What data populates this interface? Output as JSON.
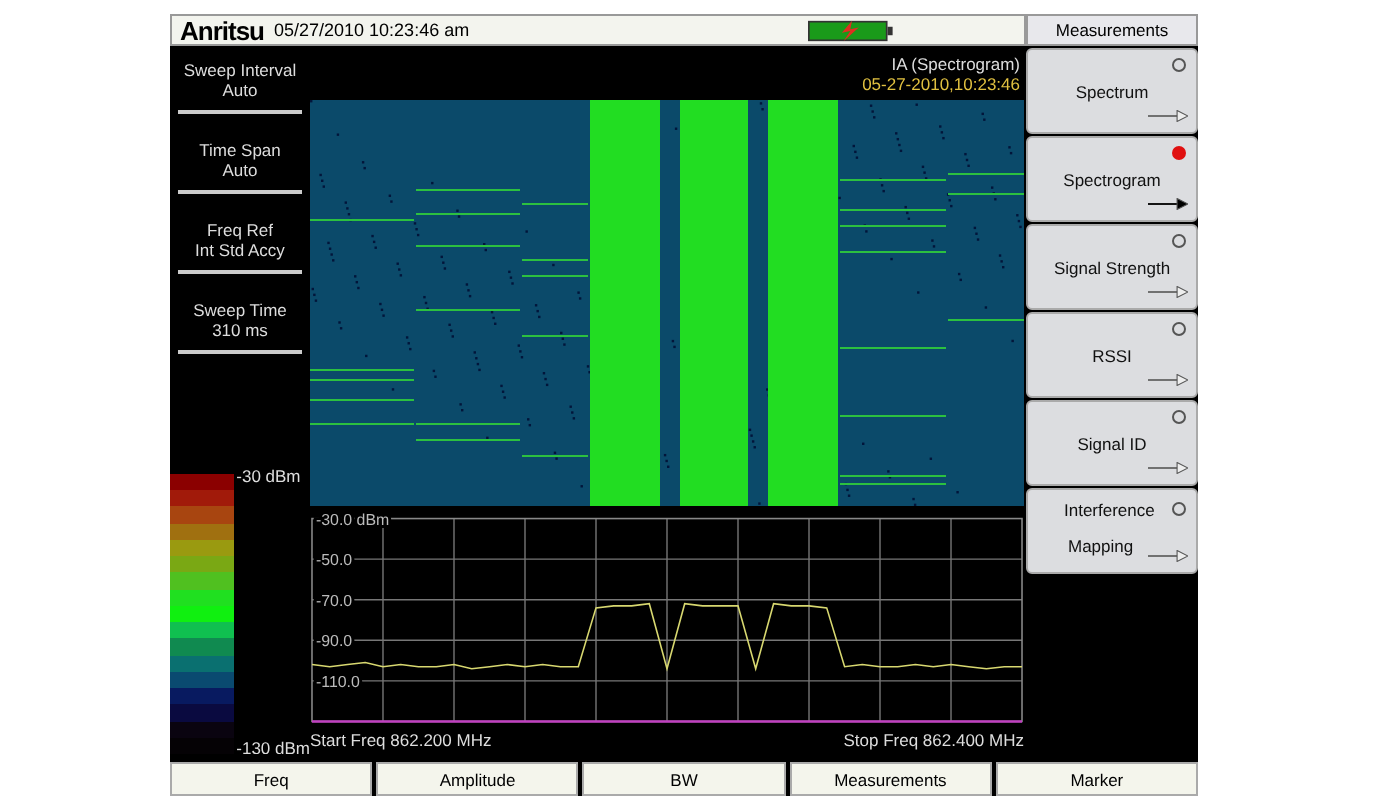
{
  "top_bar": {
    "logo": "Anritsu",
    "datetime": "05/27/2010 10:23:46 am"
  },
  "status": {
    "mode": "IA (Spectrogram)",
    "timestamp": "05-27-2010,10:23:46"
  },
  "settings": [
    {
      "label": "Sweep Interval",
      "value": "Auto"
    },
    {
      "label": "Time Span",
      "value": "Auto"
    },
    {
      "label": "Freq Ref",
      "value": "Int Std Accy"
    },
    {
      "label": "Sweep Time",
      "value": "310 ms"
    }
  ],
  "color_scale": {
    "top_label": "-30 dBm",
    "bottom_label": "-130 dBm"
  },
  "trace": {
    "chart_data": {
      "type": "line",
      "grid": true,
      "ylim": [
        -130,
        -30
      ],
      "yticks": [
        {
          "value": -30,
          "label": "-30.0 dBm"
        },
        {
          "value": -50,
          "label": "-50.0"
        },
        {
          "value": -70,
          "label": "-70.0"
        },
        {
          "value": -90,
          "label": "-90.0"
        },
        {
          "value": -110,
          "label": "-110.0"
        }
      ],
      "categories": [
        null,
        null,
        null,
        null,
        null,
        null,
        null,
        null,
        null,
        null,
        null,
        null,
        null,
        null,
        null,
        null,
        null,
        null,
        null,
        null,
        null,
        null,
        null,
        null,
        null,
        null,
        null,
        null,
        null,
        null,
        null,
        null,
        null,
        null,
        null,
        null,
        null,
        null,
        null,
        null,
        null
      ],
      "series": [
        {
          "color": "#d8d870",
          "values": [
            -102,
            -103,
            -102,
            -101,
            -103,
            -102,
            -103,
            -103,
            -102,
            -104,
            -103,
            -102,
            -103,
            -102,
            -103,
            -103,
            -74,
            -73,
            -73,
            -72,
            -104,
            -72,
            -73,
            -73,
            -73,
            -104,
            -72,
            -73,
            -73,
            -74,
            -103,
            -102,
            -103,
            -103,
            -102,
            -103,
            -102,
            -103,
            -104,
            -103,
            -103
          ]
        }
      ]
    }
  },
  "frequency": {
    "start": "Start Freq 862.200 MHz",
    "stop": "Stop Freq 862.400 MHz"
  },
  "menu": {
    "title": "Measurements",
    "items": [
      {
        "lines": [
          "Spectrum"
        ],
        "selected": false
      },
      {
        "lines": [
          "Spectrogram"
        ],
        "selected": true
      },
      {
        "lines": [
          "Signal Strength"
        ],
        "selected": false
      },
      {
        "lines": [
          "RSSI"
        ],
        "selected": false
      },
      {
        "lines": [
          "Signal ID"
        ],
        "selected": false
      },
      {
        "lines": [
          "Interference",
          "Mapping"
        ],
        "selected": false
      }
    ]
  },
  "soft_keys": [
    "Freq",
    "Amplitude",
    "BW",
    "Measurements",
    "Marker"
  ]
}
